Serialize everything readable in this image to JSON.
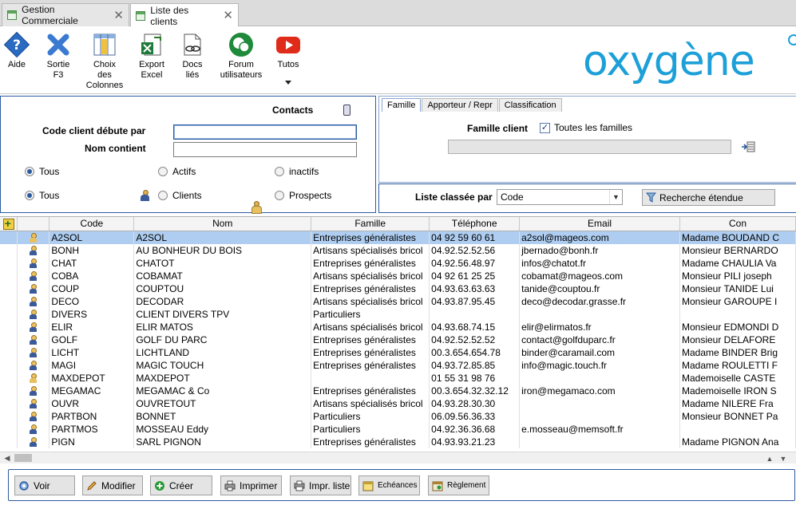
{
  "tabs": [
    {
      "label": "Gestion Commerciale",
      "active": false
    },
    {
      "label": "Liste des clients",
      "active": true
    }
  ],
  "ribbon": {
    "aide": "Aide",
    "sortie": "Sortie\nF3",
    "colonnes": "Choix\ndes\nColonnes",
    "export": "Export\nExcel",
    "docs": "Docs\nliés",
    "forum": "Forum\nutilisateurs",
    "tutos": "Tutos"
  },
  "logo": "oxygène",
  "filters": {
    "contacts_label": "Contacts",
    "code_label": "Code client débute par",
    "code_value": "",
    "nom_label": "Nom contient",
    "nom_value": "",
    "row1": {
      "tous": "Tous",
      "actifs": "Actifs",
      "inactifs": "inactifs",
      "selected": "Tous"
    },
    "row2": {
      "tous": "Tous",
      "clients": "Clients",
      "prospects": "Prospects",
      "selected": "Tous"
    }
  },
  "famille_panel": {
    "tabs": [
      "Famille",
      "Apporteur / Repr",
      "Classification"
    ],
    "active_tab": "Famille",
    "famille_label": "Famille client",
    "toutes_label": "Toutes les familles",
    "toutes_checked": true
  },
  "sort": {
    "label": "Liste classée par",
    "value": "Code",
    "search_button": "Recherche étendue"
  },
  "grid": {
    "columns": [
      "Code",
      "Nom",
      "Famille",
      "Téléphone",
      "Email",
      "Con"
    ],
    "selected_row": 0,
    "rows": [
      {
        "icon": "gold",
        "code": "A2SOL",
        "nom": "A2SOL",
        "famille": "Entreprises généralistes",
        "tel": "04 92 59 60 61",
        "email": "a2sol@mageos.com",
        "contact": "Madame BOUDAND C"
      },
      {
        "icon": "blue",
        "code": "BONH",
        "nom": "AU BONHEUR DU BOIS",
        "famille": "Artisans spécialisés bricol",
        "tel": "04.92.52.52.56",
        "email": "jbernado@bonh.fr",
        "contact": "Monsieur BERNARDO"
      },
      {
        "icon": "blue",
        "code": "CHAT",
        "nom": "CHATOT",
        "famille": "Entreprises généralistes",
        "tel": "04.92.56.48.97",
        "email": "infos@chatot.fr",
        "contact": "Madame CHAULIA Va"
      },
      {
        "icon": "blue",
        "code": "COBA",
        "nom": "COBAMAT",
        "famille": "Artisans spécialisés bricol",
        "tel": "04 92 61 25 25",
        "email": "cobamat@mageos.com",
        "contact": "Monsieur PILI joseph"
      },
      {
        "icon": "blue",
        "code": "COUP",
        "nom": "COUPTOU",
        "famille": "Entreprises généralistes",
        "tel": "04.93.63.63.63",
        "email": "tanide@couptou.fr",
        "contact": "Monsieur TANIDE Lui"
      },
      {
        "icon": "blue",
        "code": "DECO",
        "nom": "DECODAR",
        "famille": "Artisans spécialisés bricol",
        "tel": "04.93.87.95.45",
        "email": "deco@decodar.grasse.fr",
        "contact": "Monsieur GAROUPE I"
      },
      {
        "icon": "blue",
        "code": "DIVERS",
        "nom": "CLIENT DIVERS TPV",
        "famille": "Particuliers",
        "tel": "",
        "email": "",
        "contact": ""
      },
      {
        "icon": "blue",
        "code": "ELIR",
        "nom": "ELIR MATOS",
        "famille": "Artisans spécialisés bricol",
        "tel": "04.93.68.74.15",
        "email": "elir@elirmatos.fr",
        "contact": "Monsieur EDMONDI D"
      },
      {
        "icon": "blue",
        "code": "GOLF",
        "nom": "GOLF DU PARC",
        "famille": "Entreprises généralistes",
        "tel": "04.92.52.52.52",
        "email": "contact@golfduparc.fr",
        "contact": "Monsieur DELAFORE"
      },
      {
        "icon": "blue",
        "code": "LICHT",
        "nom": "LICHTLAND",
        "famille": "Entreprises généralistes",
        "tel": "00.3.654.654.78",
        "email": "binder@caramail.com",
        "contact": "Madame BINDER Brig"
      },
      {
        "icon": "blue",
        "code": "MAGI",
        "nom": "MAGIC TOUCH",
        "famille": "Entreprises généralistes",
        "tel": "04.93.72.85.85",
        "email": "info@magic.touch.fr",
        "contact": "Madame ROULETTI F"
      },
      {
        "icon": "gold",
        "code": "MAXDEPOT",
        "nom": "MAXDEPOT",
        "famille": "",
        "tel": "01 55 31 98 76",
        "email": "",
        "contact": "Mademoiselle CASTE"
      },
      {
        "icon": "blue",
        "code": "MEGAMAC",
        "nom": "MEGAMAC & Co",
        "famille": "Entreprises généralistes",
        "tel": "00.3.654.32.32.12",
        "email": "iron@megamaco.com",
        "contact": "Mademoiselle IRON S"
      },
      {
        "icon": "blue",
        "code": "OUVR",
        "nom": "OUVRETOUT",
        "famille": "Artisans spécialisés bricol",
        "tel": "04.93.28.30.30",
        "email": "",
        "contact": "Madame NILERE Fra"
      },
      {
        "icon": "blue",
        "code": "PARTBON",
        "nom": "BONNET",
        "famille": "Particuliers",
        "tel": "06.09.56.36.33",
        "email": "",
        "contact": "Monsieur BONNET Pa"
      },
      {
        "icon": "blue",
        "code": "PARTMOS",
        "nom": "MOSSEAU Eddy",
        "famille": "Particuliers",
        "tel": "04.92.36.36.68",
        "email": "e.mosseau@memsoft.fr",
        "contact": ""
      },
      {
        "icon": "blue",
        "code": "PIGN",
        "nom": "SARL PIGNON",
        "famille": "Entreprises généralistes",
        "tel": "04.93.93.21.23",
        "email": "",
        "contact": "Madame PIGNON Ana"
      }
    ]
  },
  "bottom": {
    "voir": "Voir",
    "modifier": "Modifier",
    "creer": "Créer",
    "imprimer": "Imprimer",
    "impr_liste": "Impr. liste",
    "echeances": "Echéances",
    "reglement": "Règlement"
  },
  "colors": {
    "accent": "#2c5aa0",
    "selection": "#aecdf0",
    "logo": "#1d9fd8"
  }
}
